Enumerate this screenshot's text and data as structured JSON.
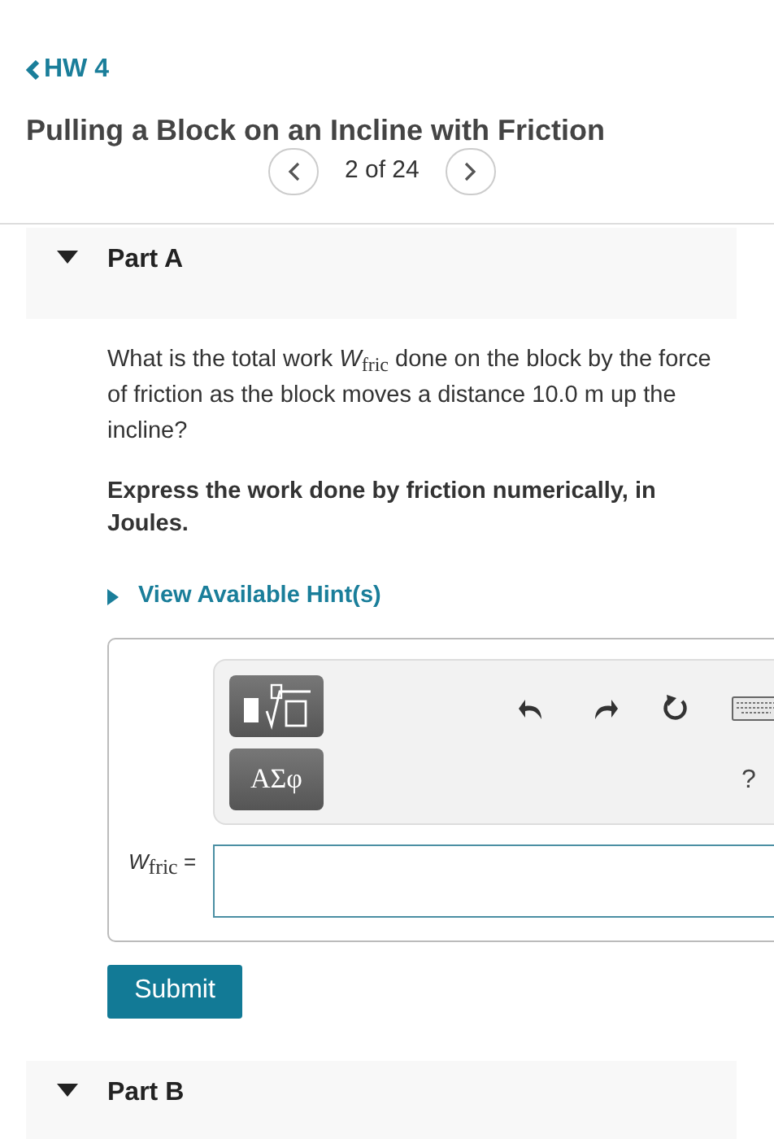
{
  "back_link": "HW 4",
  "title": "Pulling a Block on an Incline with Friction",
  "pager": {
    "position": "2 of 24"
  },
  "parts": [
    {
      "label": "Part A",
      "expanded": true,
      "question": "What is the total work *W*$_{fric}$ done on the block by the force of friction as the block moves a distance 10.0 m up the incline?",
      "instruction": "Express the work done by friction numerically, in Joules.",
      "hint": {
        "label": "View Available Hint(s)",
        "expanded": false
      },
      "toolbar": {
        "symbols": "ΑΣφ",
        "help": "?"
      },
      "answer": {
        "label": "*W*$_{fric}$ ="
      },
      "submit": "Submit"
    },
    {
      "label": "Part B",
      "expanded": true
    }
  ]
}
